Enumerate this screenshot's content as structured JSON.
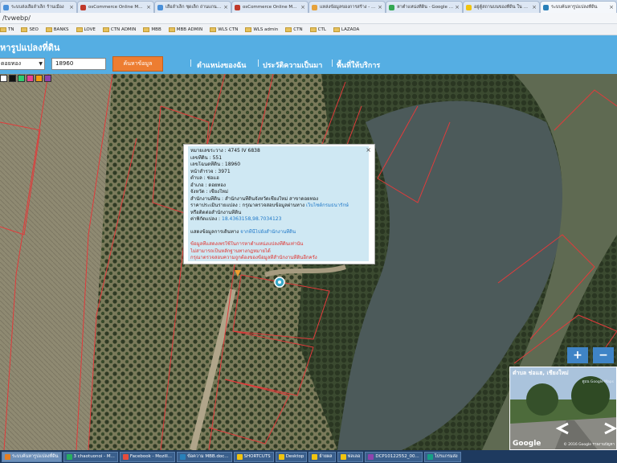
{
  "browser": {
    "tabs": [
      {
        "label": "ระบบส่งเสือลำเล็ก ร้านเมือง",
        "color": "#4a90d9"
      },
      {
        "label": "osCommerce Online Merchant",
        "color": "#c0392b"
      },
      {
        "label": "เสือลำเล็ก ชุดเล็ก ถ่านแกนเล็ก",
        "color": "#4a90d9"
      },
      {
        "label": "osCommerce Online Merchant",
        "color": "#c0392b"
      },
      {
        "label": "แหล่งข้อมูลของการสร้าง - Go",
        "color": "#e6a23c"
      },
      {
        "label": "หาตำแหน่งที่ดิน - Google Sea",
        "color": "#34a853"
      },
      {
        "label": "อยู่ตู้สถานบนของที่ดิน ใน goo",
        "color": "#f1c40f"
      },
      {
        "label": "ระบบค้นหารูปแปลงที่ดิน",
        "color": "#2980b9"
      }
    ],
    "address": "/tvwebp/",
    "bookmarks": [
      "TN",
      "SEO",
      "BANKS",
      "LOVE",
      "CTN ADMIN",
      "MBB",
      "MBB ADMIN",
      "WLS CTN",
      "WLS admin",
      "CTN",
      "CTL",
      "LAZADA"
    ]
  },
  "header": {
    "title": "หารูปแปลงที่ดิน",
    "amphoe_select": "ดอยทอง",
    "parcel_input": "18960",
    "search_button": "ค้นหาข้อมูล",
    "nav": [
      "ตำแหน่งของฉัน",
      "ประวัติความเป็นมา",
      "พื้นที่ให้บริการ"
    ],
    "palette": [
      "#ffffff",
      "#111111",
      "#2ecc71",
      "#e84393",
      "#f39c12",
      "#8e44ad"
    ]
  },
  "popup": {
    "lines": [
      "หมายเลขระวาง : 4745 IV 6838",
      "เลขที่ดิน : 551",
      "เลขโฉนดที่ดิน : 18960",
      "หน้าสำรวจ : 3971",
      "ตำบล : ช่อแฮ",
      "อำเภอ : ดอยทอง",
      "จังหวัด : เชียงใหม่",
      "สำนักงานที่ดิน : สำนักงานที่ดินจังหวัดเชียงใหม่ สาขาดอยทอง"
    ],
    "price_label": "ราคาประเมินรายแปลง : กรุณาตรวจสอบข้อมูลผ่านทาง",
    "price_link": "เว็บไซต์กรมธนารักษ์",
    "contact_line": "หรือติดต่อสำนักงานที่ดิน",
    "coords_label": "ค่าพิกัดแปลง :",
    "coords_value": "18.4363158,98.7034123",
    "route_label": "แสดงข้อมูลการเดินทาง",
    "route_link": "จากที่นี่ไปยังสำนักงานที่ดิน",
    "warning": [
      "ข้อมูลที่แสดงเพรใช้ในการหาตำแหน่งแปลงที่ดินเท่านั้น",
      "ไม่สามารถเป็นหลักฐานทางกฎหมายได้",
      "กรุณาตรวจสอบความถูกต้องของข้อมูลที่สำนักงานที่ดินอีกครั้ง"
    ],
    "close": "×"
  },
  "map_controls": {
    "zoom_in": "+",
    "zoom_out": "−"
  },
  "streetview": {
    "title": "ตำบล ช่อแฮ, เชียงใหม่",
    "link": "ดูบน Google Maps",
    "logo": "Google",
    "copyright": "© 2016 Google  รายงานปัญหา"
  },
  "taskbar": [
    {
      "label": "ระบบค้นหารูปแปลงที่ดิน",
      "color": "#e67e22",
      "active": true
    },
    {
      "label": "3 chaotuonoi - M...",
      "color": "#27ae60",
      "active": false
    },
    {
      "label": "Facebook - Mozill...",
      "color": "#e74c3c",
      "active": false
    },
    {
      "label": "ข้อความ MBB.doc...",
      "color": "#2980b9",
      "active": false
    },
    {
      "label": "SHORTCUTS",
      "color": "#f1c40f",
      "active": false
    },
    {
      "label": "Desktop",
      "color": "#f1c40f",
      "active": false
    },
    {
      "label": "ย้ายผล",
      "color": "#f1c40f",
      "active": false
    },
    {
      "label": "ฟลเลอ",
      "color": "#f1c40f",
      "active": false
    },
    {
      "label": "DCP10122552_00...",
      "color": "#8e44ad",
      "active": false
    },
    {
      "label": "โปรแกรมส่ง",
      "color": "#16a085",
      "active": false
    }
  ]
}
